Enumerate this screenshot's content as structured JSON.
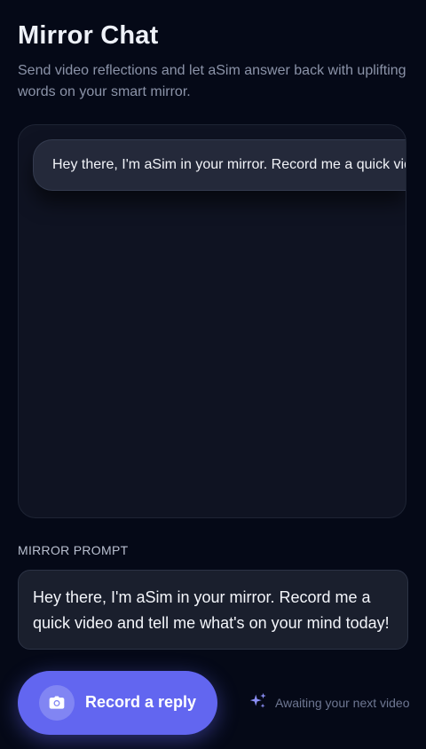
{
  "header": {
    "title": "Mirror Chat",
    "subtitle": "Send video reflections and let aSim answer back with uplifting words on your smart mirror."
  },
  "chat": {
    "messages": [
      {
        "text": "Hey there, I'm aSim in your mirror. Record me a quick video and tell me what's on your mind today!"
      }
    ]
  },
  "prompt": {
    "label": "MIRROR PROMPT",
    "text": "Hey there, I'm aSim in your mirror. Record me a quick video and tell me what's on your mind today!"
  },
  "actions": {
    "record_label": "Record a reply",
    "record_icon": "camera-icon",
    "status_icon": "sparkles-icon",
    "status_text": "Awaiting your next video"
  },
  "colors": {
    "background": "#050917",
    "accent": "#6266f0",
    "status_icon": "#8b8ff5"
  }
}
